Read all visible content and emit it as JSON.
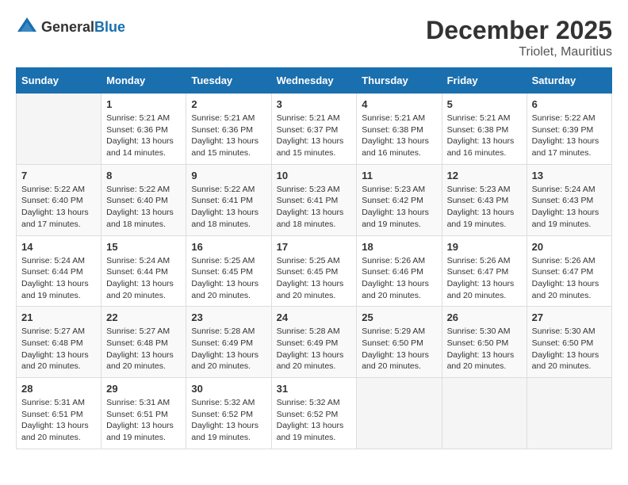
{
  "logo": {
    "text_general": "General",
    "text_blue": "Blue"
  },
  "title": {
    "month": "December 2025",
    "location": "Triolet, Mauritius"
  },
  "headers": [
    "Sunday",
    "Monday",
    "Tuesday",
    "Wednesday",
    "Thursday",
    "Friday",
    "Saturday"
  ],
  "weeks": [
    [
      {
        "day": "",
        "info": ""
      },
      {
        "day": "1",
        "info": "Sunrise: 5:21 AM\nSunset: 6:36 PM\nDaylight: 13 hours\nand 14 minutes."
      },
      {
        "day": "2",
        "info": "Sunrise: 5:21 AM\nSunset: 6:36 PM\nDaylight: 13 hours\nand 15 minutes."
      },
      {
        "day": "3",
        "info": "Sunrise: 5:21 AM\nSunset: 6:37 PM\nDaylight: 13 hours\nand 15 minutes."
      },
      {
        "day": "4",
        "info": "Sunrise: 5:21 AM\nSunset: 6:38 PM\nDaylight: 13 hours\nand 16 minutes."
      },
      {
        "day": "5",
        "info": "Sunrise: 5:21 AM\nSunset: 6:38 PM\nDaylight: 13 hours\nand 16 minutes."
      },
      {
        "day": "6",
        "info": "Sunrise: 5:22 AM\nSunset: 6:39 PM\nDaylight: 13 hours\nand 17 minutes."
      }
    ],
    [
      {
        "day": "7",
        "info": "Sunrise: 5:22 AM\nSunset: 6:40 PM\nDaylight: 13 hours\nand 17 minutes."
      },
      {
        "day": "8",
        "info": "Sunrise: 5:22 AM\nSunset: 6:40 PM\nDaylight: 13 hours\nand 18 minutes."
      },
      {
        "day": "9",
        "info": "Sunrise: 5:22 AM\nSunset: 6:41 PM\nDaylight: 13 hours\nand 18 minutes."
      },
      {
        "day": "10",
        "info": "Sunrise: 5:23 AM\nSunset: 6:41 PM\nDaylight: 13 hours\nand 18 minutes."
      },
      {
        "day": "11",
        "info": "Sunrise: 5:23 AM\nSunset: 6:42 PM\nDaylight: 13 hours\nand 19 minutes."
      },
      {
        "day": "12",
        "info": "Sunrise: 5:23 AM\nSunset: 6:43 PM\nDaylight: 13 hours\nand 19 minutes."
      },
      {
        "day": "13",
        "info": "Sunrise: 5:24 AM\nSunset: 6:43 PM\nDaylight: 13 hours\nand 19 minutes."
      }
    ],
    [
      {
        "day": "14",
        "info": "Sunrise: 5:24 AM\nSunset: 6:44 PM\nDaylight: 13 hours\nand 19 minutes."
      },
      {
        "day": "15",
        "info": "Sunrise: 5:24 AM\nSunset: 6:44 PM\nDaylight: 13 hours\nand 20 minutes."
      },
      {
        "day": "16",
        "info": "Sunrise: 5:25 AM\nSunset: 6:45 PM\nDaylight: 13 hours\nand 20 minutes."
      },
      {
        "day": "17",
        "info": "Sunrise: 5:25 AM\nSunset: 6:45 PM\nDaylight: 13 hours\nand 20 minutes."
      },
      {
        "day": "18",
        "info": "Sunrise: 5:26 AM\nSunset: 6:46 PM\nDaylight: 13 hours\nand 20 minutes."
      },
      {
        "day": "19",
        "info": "Sunrise: 5:26 AM\nSunset: 6:47 PM\nDaylight: 13 hours\nand 20 minutes."
      },
      {
        "day": "20",
        "info": "Sunrise: 5:26 AM\nSunset: 6:47 PM\nDaylight: 13 hours\nand 20 minutes."
      }
    ],
    [
      {
        "day": "21",
        "info": "Sunrise: 5:27 AM\nSunset: 6:48 PM\nDaylight: 13 hours\nand 20 minutes."
      },
      {
        "day": "22",
        "info": "Sunrise: 5:27 AM\nSunset: 6:48 PM\nDaylight: 13 hours\nand 20 minutes."
      },
      {
        "day": "23",
        "info": "Sunrise: 5:28 AM\nSunset: 6:49 PM\nDaylight: 13 hours\nand 20 minutes."
      },
      {
        "day": "24",
        "info": "Sunrise: 5:28 AM\nSunset: 6:49 PM\nDaylight: 13 hours\nand 20 minutes."
      },
      {
        "day": "25",
        "info": "Sunrise: 5:29 AM\nSunset: 6:50 PM\nDaylight: 13 hours\nand 20 minutes."
      },
      {
        "day": "26",
        "info": "Sunrise: 5:30 AM\nSunset: 6:50 PM\nDaylight: 13 hours\nand 20 minutes."
      },
      {
        "day": "27",
        "info": "Sunrise: 5:30 AM\nSunset: 6:50 PM\nDaylight: 13 hours\nand 20 minutes."
      }
    ],
    [
      {
        "day": "28",
        "info": "Sunrise: 5:31 AM\nSunset: 6:51 PM\nDaylight: 13 hours\nand 20 minutes."
      },
      {
        "day": "29",
        "info": "Sunrise: 5:31 AM\nSunset: 6:51 PM\nDaylight: 13 hours\nand 19 minutes."
      },
      {
        "day": "30",
        "info": "Sunrise: 5:32 AM\nSunset: 6:52 PM\nDaylight: 13 hours\nand 19 minutes."
      },
      {
        "day": "31",
        "info": "Sunrise: 5:32 AM\nSunset: 6:52 PM\nDaylight: 13 hours\nand 19 minutes."
      },
      {
        "day": "",
        "info": ""
      },
      {
        "day": "",
        "info": ""
      },
      {
        "day": "",
        "info": ""
      }
    ]
  ]
}
